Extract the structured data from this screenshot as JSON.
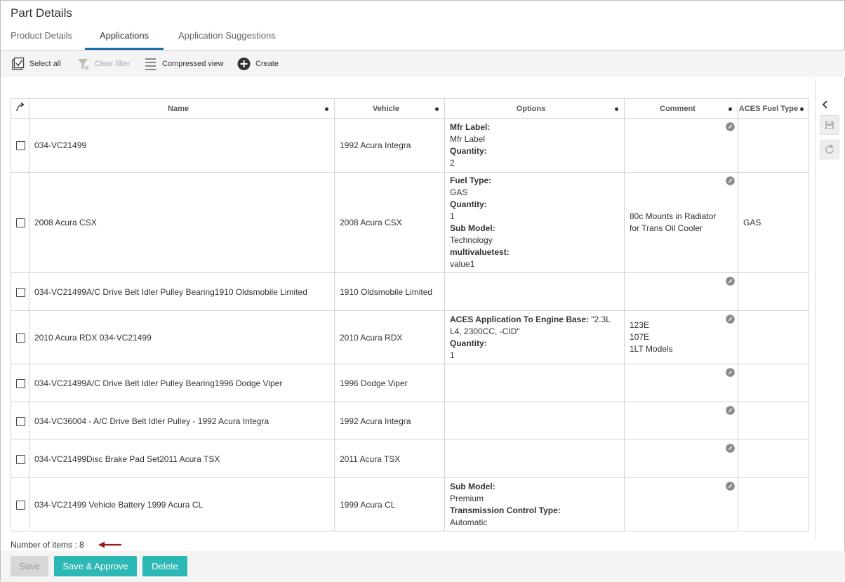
{
  "page": {
    "title": "Part Details"
  },
  "tabs": [
    {
      "label": "Product Details"
    },
    {
      "label": "Applications"
    },
    {
      "label": "Application Suggestions"
    }
  ],
  "toolbar": {
    "select_all": "Select all",
    "clear_filter": "Clear filter",
    "compressed_view": "Compressed view",
    "create": "Create"
  },
  "grid": {
    "columns": {
      "name": "Name",
      "vehicle": "Vehicle",
      "options": "Options",
      "comment": "Comment",
      "fuel": "ACES Fuel Type"
    },
    "rows": [
      {
        "name": "034-VC21499",
        "vehicle": "1992 Acura Integra",
        "options": [
          {
            "key": "Mfr Label:",
            "value": " Mfr Label"
          },
          {
            "key": "Quantity:",
            "value": "2"
          }
        ],
        "comment": [],
        "fuel": ""
      },
      {
        "name": "2008 Acura CSX",
        "vehicle": "2008 Acura CSX",
        "options": [
          {
            "key": "Fuel Type:",
            "value": "GAS"
          },
          {
            "key": "Quantity:",
            "value": "1"
          },
          {
            "key": "Sub Model:",
            "value": "Technology"
          },
          {
            "key": "multivaluetest:",
            "value": "value1"
          }
        ],
        "comment": [
          "80c Mounts in Radiator",
          "for Trans Oil Cooler"
        ],
        "fuel": "GAS"
      },
      {
        "name": "034-VC21499A/C Drive Belt Idler Pulley Bearing1910 Oldsmobile Limited",
        "vehicle": "1910 Oldsmobile Limited",
        "options": [],
        "comment": [],
        "fuel": ""
      },
      {
        "name": "2010 Acura RDX 034-VC21499",
        "vehicle": "2010 Acura RDX",
        "options": [
          {
            "key": "ACES Application To Engine Base:",
            "inline": " \"2.3L L4, 2300CC, -CID\""
          },
          {
            "key": "Quantity:",
            "value": "1"
          }
        ],
        "comment": [
          "123E",
          "107E",
          "1LT Models"
        ],
        "fuel": ""
      },
      {
        "name": "034-VC21499A/C Drive Belt Idler Pulley Bearing1996 Dodge Viper",
        "vehicle": "1996 Dodge Viper",
        "options": [],
        "comment": [],
        "fuel": ""
      },
      {
        "name": "034-VC36004 - A/C Drive Belt Idler Pulley - 1992 Acura Integra",
        "vehicle": "1992 Acura Integra",
        "options": [],
        "comment": [],
        "fuel": ""
      },
      {
        "name": "034-VC21499Disc Brake Pad Set2011 Acura TSX",
        "vehicle": "2011 Acura TSX",
        "options": [],
        "comment": [],
        "fuel": ""
      },
      {
        "name": "034-VC21499 Vehicle Battery 1999 Acura CL",
        "vehicle": "1999 Acura CL",
        "options": [
          {
            "key": "Sub Model:",
            "value": "Premium"
          },
          {
            "key": "Transmission Control Type:",
            "value": "Automatic"
          }
        ],
        "comment": [],
        "fuel": ""
      }
    ]
  },
  "footer": {
    "count_text": "Number of items : 8",
    "save": "Save",
    "save_approve": "Save & Approve",
    "delete": "Delete"
  },
  "colors": {
    "accent_teal": "#2cb8b5",
    "link_blue": "#1b6fa8",
    "arrow_red": "#9b1c1c"
  },
  "icons": {
    "select_all": "checklist-icon",
    "clear_filter": "filter-clear-icon",
    "compressed_view": "lines-icon",
    "create": "plus-circle-icon",
    "header_corner": "refresh-arrow-icon",
    "row_edit": "edit-pencil-icon",
    "side": [
      "chevron-left-icon",
      "save-disk-icon",
      "refresh-icon"
    ]
  }
}
